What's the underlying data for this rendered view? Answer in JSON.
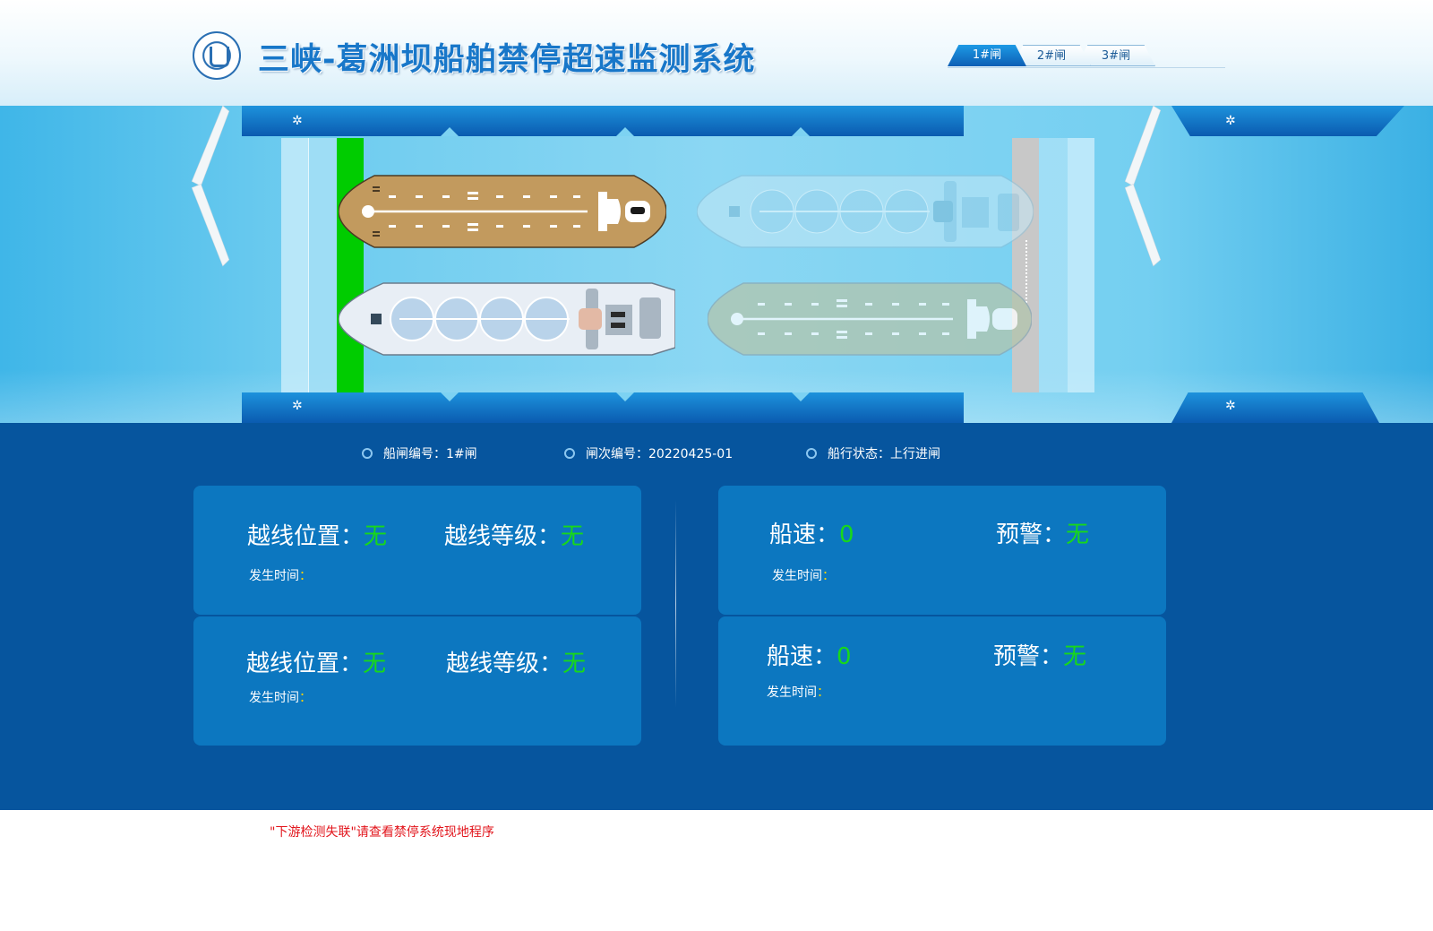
{
  "header": {
    "title": "三峡-葛洲坝船舶禁停超速监测系统",
    "tabs": [
      {
        "label": "1#闸",
        "active": true
      },
      {
        "label": "2#闸",
        "active": false
      },
      {
        "label": "3#闸",
        "active": false
      }
    ]
  },
  "status": {
    "lock_no_label": "船闸编号：",
    "lock_no_value": "1#闸",
    "batch_no_label": "闸次编号：",
    "batch_no_value": "20220425-01",
    "state_label": "船行状态：",
    "state_value": "上行进闸"
  },
  "panels": {
    "crossing_1": {
      "position_label": "越线位置：",
      "position_value": "无",
      "level_label": "越线等级：",
      "level_value": "无",
      "time_label": "发生时间",
      "colon": "："
    },
    "crossing_2": {
      "position_label": "越线位置：",
      "position_value": "无",
      "level_label": "越线等级：",
      "level_value": "无",
      "time_label": "发生时间",
      "colon": "："
    },
    "speed_1": {
      "speed_label": "船速：",
      "speed_value": "0",
      "warning_label": "预警：",
      "warning_value": "无",
      "time_label": "发生时间",
      "colon": "："
    },
    "speed_2": {
      "speed_label": "船速：",
      "speed_value": "0",
      "warning_label": "预警：",
      "warning_value": "无",
      "time_label": "发生时间",
      "colon": "："
    }
  },
  "footer_warning": "\"下游检测失联\"请查看禁停系统现地程序",
  "colors": {
    "brand_blue": "#1877c9",
    "panel_bg": "#0c77c0",
    "info_bg": "#06559e",
    "value_green": "#18d81a",
    "gate_green": "#00cc00",
    "warning_red": "#e2141b"
  },
  "icons": [
    "logo-emblem-icon",
    "gear-icon",
    "ring-bullet-icon",
    "cargo-ship-icon",
    "tanker-ship-icon"
  ]
}
